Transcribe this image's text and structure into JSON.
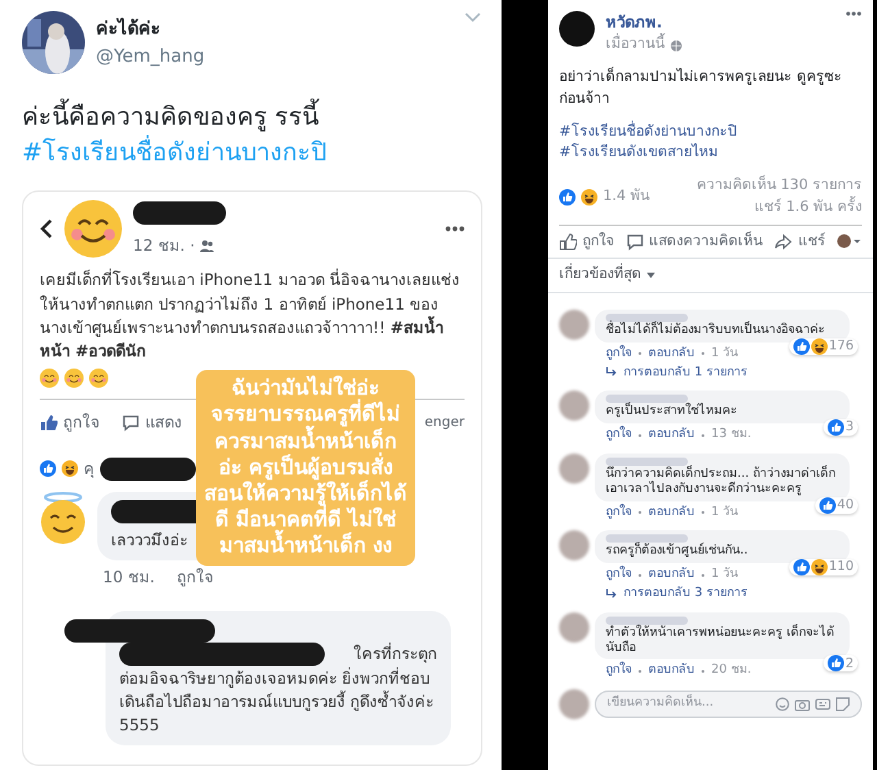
{
  "tweet": {
    "display_name": "ค่ะได้ค่ะ",
    "handle": "@Yem_hang",
    "text": "ค่ะนี้คือความคิดของครู รรนี้",
    "hashtag": "#โรงเรียนชื่อดังย่านบางกะปิ"
  },
  "embedded_post": {
    "time": "12 ชม. ·",
    "text": "เคยมีเด็กที่โรงเรียนเอา iPhone11 มาอวด นี่อิจฉานางเลยแช่งให้นางทำตกแตก ปรากฏว่าไม่ถึง 1 อาทิตย์ iPhone11 ของนางเข้าศูนย์เพราะนางทำตกบนรถสองแถวจ้าาาาา!! **#สมน้ำหน้า #อวดดีนัก**",
    "actions": [
      {
        "label": "ถูกใจ",
        "kind": "like"
      },
      {
        "label": "แสดง",
        "kind": "comment"
      },
      {
        "label": "enger",
        "kind": "messenger"
      }
    ],
    "reactions_text": "คุ",
    "comment": {
      "text": "เลวววมึงอ่ะ",
      "time": "10 ชม.",
      "like": "ถูกใจ"
    },
    "reply": {
      "first_line": "ใครที่กระตุก",
      "text": "ต่อมอิจฉาริษยากูต้องเจอหมดค่ะ ยิ่งพวกที่ชอบเดินถือไปถือมาอารมณ์แบบกูรวยงี้ กูดึงซ้ำจังค่ะ 5555"
    }
  },
  "caption": "ฉันว่ามันไม่ใช่อ่ะ จรรยาบรรณครูที่ดีไม่ควรมาสมน้ำหน้าเด็กอ่ะ ครูเป็นผู้อบรมสั่งสอนให้ความรู้ให้เด็กได้ดี มีอนาคตที่ดี ไม่ใช่มาสมน้ำหน้าเด็ก งง",
  "fb_post": {
    "author": "หวัดภพ.",
    "time": "เมื่อวานนี้",
    "text": "อย่าว่าเด็กลามปามไม่เคารพครูเลยนะ ดูครูซะก่อนจ้าา",
    "hashtags": [
      "#โรงเรียนชื่อดังย่านบางกะปิ",
      "#โรงเรียนดังเขตสายไหม"
    ],
    "reaction_count": "1.4 พัน",
    "comment_count": "ความคิดเห็น 130 รายการ",
    "share_count": "แชร์ 1.6 พัน ครั้ง",
    "actions": [
      {
        "label": "ถูกใจ",
        "kind": "like"
      },
      {
        "label": "แสดงความคิดเห็น",
        "kind": "comment"
      },
      {
        "label": "แชร์",
        "kind": "share"
      }
    ],
    "sort": "เกี่ยวข้องที่สุด",
    "comments": [
      {
        "text": "ชื่อไม่ได้ก็ไม่ต้องมาริบบทเป็นนางอิจฉาค่ะ",
        "reactions": "176",
        "haha": true,
        "like": "ถูกใจ",
        "reply": "ตอบกลับ",
        "time": "1 วัน",
        "replies": "การตอบกลับ 1 รายการ"
      },
      {
        "text": "ครูเป็นประสาทใช่ไหมคะ",
        "reactions": "3",
        "haha": false,
        "like": "ถูกใจ",
        "reply": "ตอบกลับ",
        "time": "13 ชม."
      },
      {
        "text": "นึกว่าความคิดเด็กประถม... ถ้าว่างมาด่าเด็กเอาเวลาไปลงกับงานจะดีกว่านะคะครู",
        "reactions": "40",
        "haha": false,
        "like": "ถูกใจ",
        "reply": "ตอบกลับ",
        "time": "1 วัน"
      },
      {
        "text": "รถครูก็ต้องเข้าศูนย์เช่นกัน..",
        "reactions": "110",
        "haha": true,
        "like": "ถูกใจ",
        "reply": "ตอบกลับ",
        "time": "1 วัน",
        "replies": "การตอบกลับ 3 รายการ"
      },
      {
        "text": "ทำตัวให้หน้าเคารพหน่อยนะคะครู เด็กจะได้นับถือ",
        "reactions": "2",
        "haha": false,
        "like": "ถูกใจ",
        "reply": "ตอบกลับ",
        "time": "20 ชม."
      }
    ],
    "comment_placeholder": "เขียนความคิดเห็น..."
  }
}
